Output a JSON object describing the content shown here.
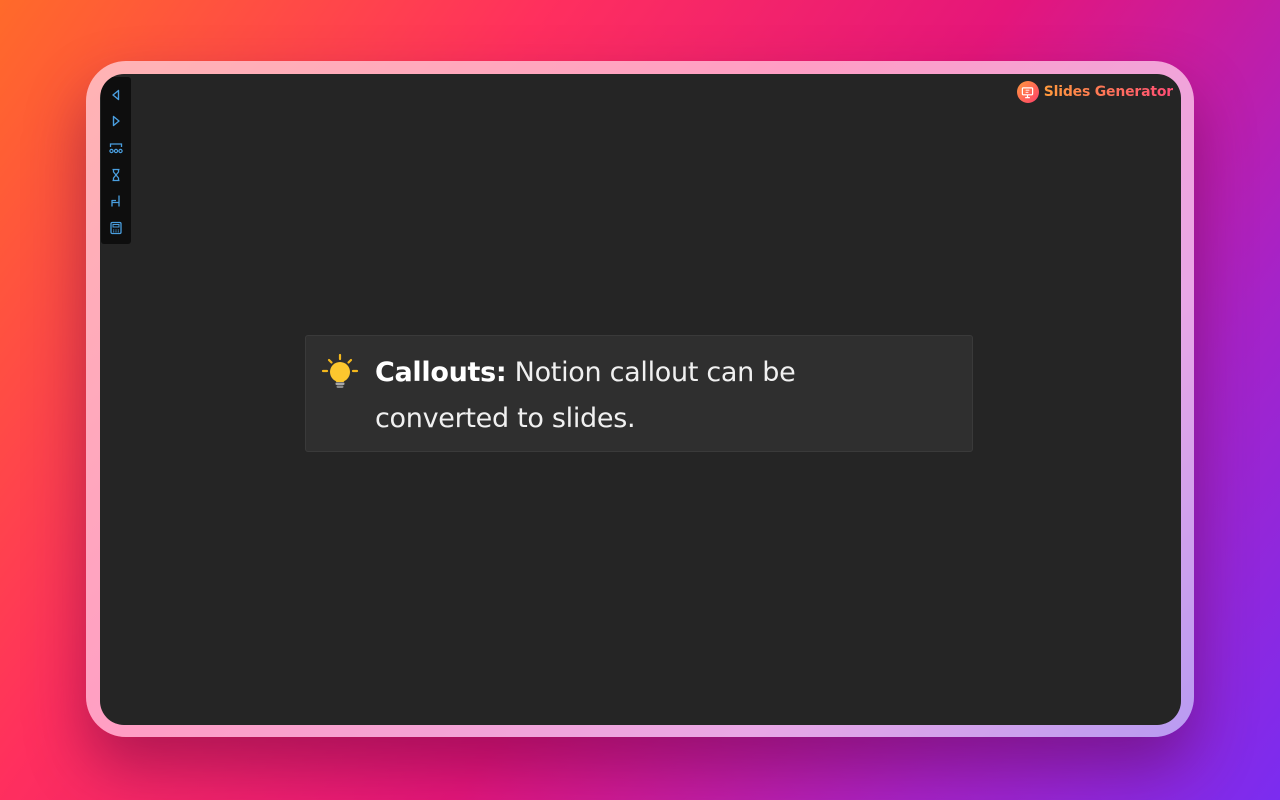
{
  "brand": {
    "name": "Slides Generator",
    "logo_icon": "slides-logo-icon"
  },
  "toolbar": {
    "items": [
      {
        "name": "previous-slide",
        "icon": "triangle-left-icon"
      },
      {
        "name": "next-slide",
        "icon": "triangle-right-icon"
      },
      {
        "name": "slide-overview",
        "icon": "grid-overview-icon"
      },
      {
        "name": "timer",
        "icon": "hourglass-icon"
      },
      {
        "name": "presenter-tools",
        "icon": "chair-icon"
      },
      {
        "name": "calculator",
        "icon": "calculator-icon"
      }
    ]
  },
  "callout": {
    "emoji": "lightbulb-icon",
    "label": "Callouts:",
    "text": " Notion callout can be converted to slides."
  },
  "colors": {
    "background_gradient": [
      "#ff6a2a",
      "#e5167a",
      "#7b2cf0"
    ],
    "screen": "#252525",
    "callout_bg": "#2f2f2f",
    "toolbar_icon": "#4a9fe0",
    "brand_accent": "#ff6a4a"
  }
}
